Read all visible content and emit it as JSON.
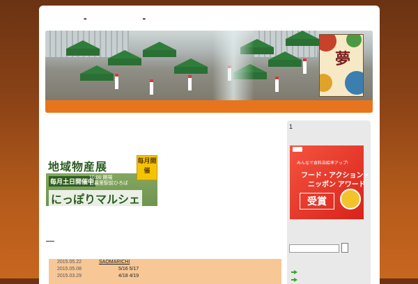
{
  "header": {
    "site_title": "- -"
  },
  "banner": {
    "poster_text": "夢"
  },
  "main": {
    "promo": {
      "title": "地域物産展",
      "badge": "毎月開催",
      "subtitle": "毎月土日開催中",
      "info_line1": "10:00 開場",
      "info_line2": "日暮里駅前ひろば",
      "brand": "にっぽりマルシェ"
    },
    "news": [
      {
        "date": "2015.05.22",
        "title": "SAOMARICHI",
        "range": ""
      },
      {
        "date": "2015.05.08",
        "title": "",
        "range": "5/16 5/17"
      },
      {
        "date": "2015.03.29",
        "title": "",
        "range": "4/18 4/19"
      }
    ]
  },
  "sidebar": {
    "heading": "1",
    "award": {
      "line1": "みんなで食料自給率アップ!",
      "line2": "フード・アクション・",
      "line3": "ニッポン アワード",
      "prize": "受賞"
    },
    "search": {
      "value": ""
    },
    "colors": {
      "accent": "#35a52a"
    }
  },
  "colors": {
    "header_orange": "#e8751d",
    "news_bg": "#f7c796",
    "award_red": "#e1261c",
    "background_brown": "#8a4216"
  }
}
